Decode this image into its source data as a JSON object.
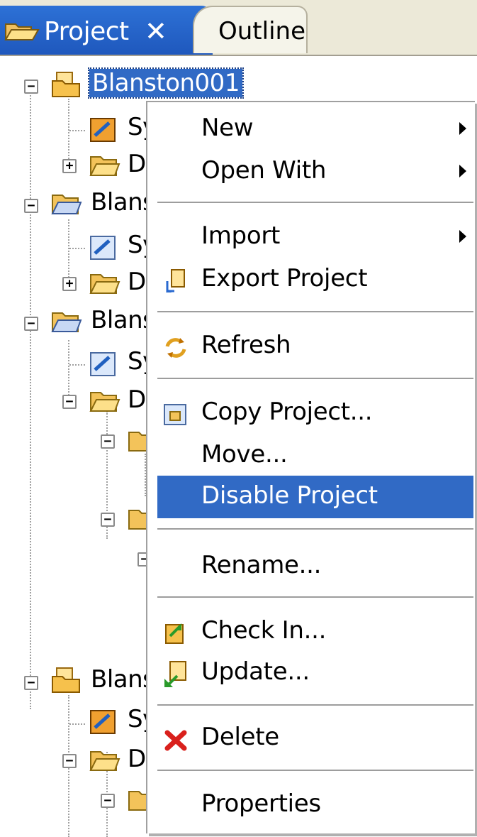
{
  "tabs": [
    {
      "label": "Project",
      "close": "✕",
      "active": true
    },
    {
      "label": "Outline",
      "active": false
    }
  ],
  "tree": {
    "nodes": [
      {
        "label": "Blanston001",
        "selected": true
      },
      {
        "label": "Sy"
      },
      {
        "label": "D"
      },
      {
        "label": "Blans"
      },
      {
        "label": "Sy"
      },
      {
        "label": "D"
      },
      {
        "label": "Blans"
      },
      {
        "label": "Sy"
      },
      {
        "label": "D"
      },
      {
        "label": "Blans"
      },
      {
        "label": "Sy"
      },
      {
        "label": "D"
      }
    ]
  },
  "context_menu": {
    "items": [
      {
        "label": "New",
        "submenu": true
      },
      {
        "label": "Open With",
        "submenu": true
      },
      {
        "label": "Import",
        "submenu": true
      },
      {
        "label": "Export Project",
        "icon": "export-project-icon"
      },
      {
        "label": "Refresh",
        "icon": "refresh-icon"
      },
      {
        "label": "Copy Project...",
        "icon": "copy-project-icon"
      },
      {
        "label": "Move..."
      },
      {
        "label": "Disable Project",
        "highlighted": true
      },
      {
        "label": "Rename..."
      },
      {
        "label": "Check In...",
        "icon": "check-in-icon"
      },
      {
        "label": "Update...",
        "icon": "update-icon"
      },
      {
        "label": "Delete",
        "icon": "delete-icon"
      },
      {
        "label": "Properties"
      }
    ]
  },
  "colors": {
    "selection": "#316ac5",
    "tab_active": "#2d71d6",
    "tab_strip": "#ece9d8",
    "folder": "#f3c35a",
    "delete_red": "#d9201c"
  }
}
